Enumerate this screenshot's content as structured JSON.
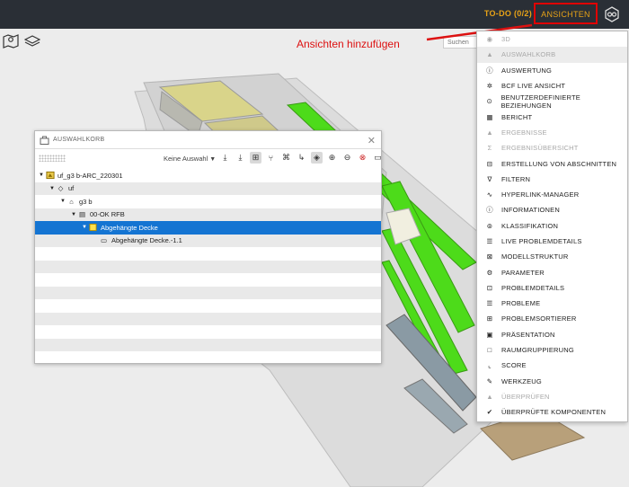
{
  "topbar": {
    "todo": "TO-DO (0/2)",
    "ansichten": "ANSICHTEN"
  },
  "search": {
    "placeholder": "Suchen"
  },
  "annotation": {
    "text": "Ansichten hinzufügen"
  },
  "panel": {
    "title": "AUSWAHLKORB",
    "selection_label": "Keine Auswahl",
    "tree": [
      {
        "label": "uf_g3 b-ARC_220301",
        "level": 0,
        "icon": "model-icon",
        "expanded": true,
        "selected": false
      },
      {
        "label": "uf",
        "level": 1,
        "icon": "floor-icon",
        "expanded": true,
        "selected": false
      },
      {
        "label": "g3 b",
        "level": 2,
        "icon": "building-icon",
        "expanded": true,
        "selected": false
      },
      {
        "label": "00-OK RFB",
        "level": 3,
        "icon": "storey-icon",
        "expanded": true,
        "selected": false
      },
      {
        "label": "Abgehängte Decke",
        "level": 4,
        "icon": "folder-icon",
        "expanded": true,
        "selected": true
      },
      {
        "label": "Abgehängte Decke.-1.1",
        "level": 5,
        "icon": "element-icon",
        "expanded": false,
        "selected": false
      }
    ]
  },
  "menu": {
    "items": [
      {
        "label": "3D",
        "icon": "cube-icon",
        "disabled": true
      },
      {
        "label": "AUSWAHLKORB",
        "icon": "basket-icon",
        "disabled": true,
        "highlight": true
      },
      {
        "label": "AUSWERTUNG",
        "icon": "info-box-icon",
        "disabled": false
      },
      {
        "label": "BCF LIVE ANSICHT",
        "icon": "bcf-icon",
        "disabled": false
      },
      {
        "label": "BENUTZERDEFINIERTE BEZIEHUNGEN",
        "icon": "relations-icon",
        "disabled": false
      },
      {
        "label": "BERICHT",
        "icon": "table-icon",
        "disabled": false
      },
      {
        "label": "ERGEBNISSE",
        "icon": "warning-icon",
        "disabled": true
      },
      {
        "label": "ERGEBNISÜBERSICHT",
        "icon": "sum-icon",
        "disabled": true
      },
      {
        "label": "ERSTELLUNG VON ABSCHNITTEN",
        "icon": "section-icon",
        "disabled": false
      },
      {
        "label": "FILTERN",
        "icon": "filter-icon",
        "disabled": false
      },
      {
        "label": "HYPERLINK-MANAGER",
        "icon": "link-icon",
        "disabled": false
      },
      {
        "label": "INFORMATIONEN",
        "icon": "info-icon",
        "disabled": false
      },
      {
        "label": "KLASSIFIKATION",
        "icon": "classification-icon",
        "disabled": false
      },
      {
        "label": "LIVE PROBLEMDETAILS",
        "icon": "live-details-icon",
        "disabled": false
      },
      {
        "label": "MODELLSTRUKTUR",
        "icon": "model-structure-icon",
        "disabled": false
      },
      {
        "label": "PARAMETER",
        "icon": "gear-icon",
        "disabled": false
      },
      {
        "label": "PROBLEMDETAILS",
        "icon": "problem-details-icon",
        "disabled": false
      },
      {
        "label": "PROBLEME",
        "icon": "list-icon",
        "disabled": false
      },
      {
        "label": "PROBLEMSORTIERER",
        "icon": "sorter-icon",
        "disabled": false
      },
      {
        "label": "PRÄSENTATION",
        "icon": "presentation-icon",
        "disabled": false
      },
      {
        "label": "RAUMGRUPPIERUNG",
        "icon": "room-icon",
        "disabled": false
      },
      {
        "label": "SCORE",
        "icon": "chart-icon",
        "disabled": false
      },
      {
        "label": "WERKZEUG",
        "icon": "wrench-icon",
        "disabled": false
      },
      {
        "label": "ÜBERPRÜFEN",
        "icon": "check-basket-icon",
        "disabled": true
      },
      {
        "label": "ÜBERPRÜFTE KOMPONENTEN",
        "icon": "checked-icon",
        "disabled": false
      }
    ]
  },
  "colors": {
    "topbar": "#2a2f36",
    "accent": "#e8a317",
    "highlight_red": "#e00000",
    "selection": "#1474d2",
    "slab_green": "#4ddb1a"
  }
}
